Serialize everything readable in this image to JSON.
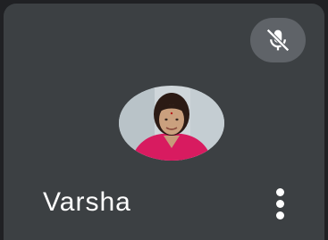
{
  "participant": {
    "name": "Varsha",
    "mic_status_icon": "mic-off-icon",
    "avatar_icon": "participant-avatar"
  },
  "actions": {
    "more_icon": "more-vert-icon"
  },
  "colors": {
    "tile_background": "#3c4043",
    "mute_badge": "#5f6368",
    "text": "#ffffff"
  }
}
